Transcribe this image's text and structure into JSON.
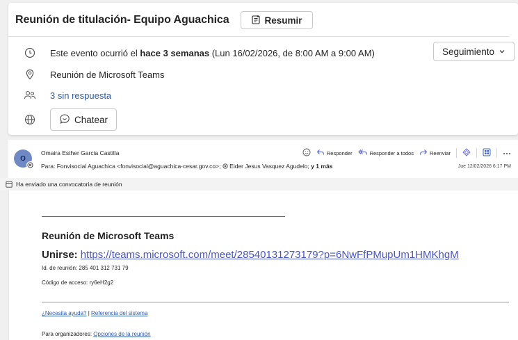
{
  "event": {
    "subject": "Reunión de titulación- Equipo Aguachica",
    "summarize_label": "Resumir",
    "time_prefix": "Este evento ocurrió el ",
    "time_bold": "hace 3 semanas",
    "time_suffix": " (Lun 16/02/2026, de 8:00 AM a 9:00 AM)",
    "follow_label": "Seguimiento",
    "location": "Reunión de Microsoft Teams",
    "attendees": "3 sin respuesta",
    "chat_label": "Chatear"
  },
  "message": {
    "avatar_initial": "O",
    "sender": "Omaira Esther Garcia Castilla",
    "to_prefix": "Para: ",
    "to_list": "Fonvisocial Aguachica <fonvisocial@aguachica-cesar.gov.co>; ",
    "to_second": " Eider Jesus Vasquez Agudelo; ",
    "to_more": "y 1 más",
    "actions": {
      "reply": "Responder",
      "reply_all": "Responder a todos",
      "forward": "Reenviar"
    },
    "timestamp": "Jue 12/02/2026 6:17 PM",
    "invite_notice": "Ha enviado una convocatoria de reunión"
  },
  "body": {
    "teams_title": "Reunión de Microsoft Teams",
    "join_label": "Unirse:",
    "join_url": "https://teams.microsoft.com/meet/28540131273179?p=6NwFfPMupUm1HMKhgM",
    "meeting_id": "Id. de reunión: 285 401 312 731 79",
    "passcode": "Código de acceso: ry6eH2g2",
    "help_link": "¿Necesita ayuda?",
    "help_sep": " | ",
    "system_ref": "Referencia del sistema",
    "org_prefix": "Para organizadores: ",
    "org_link": "Opciones de la reunión"
  }
}
